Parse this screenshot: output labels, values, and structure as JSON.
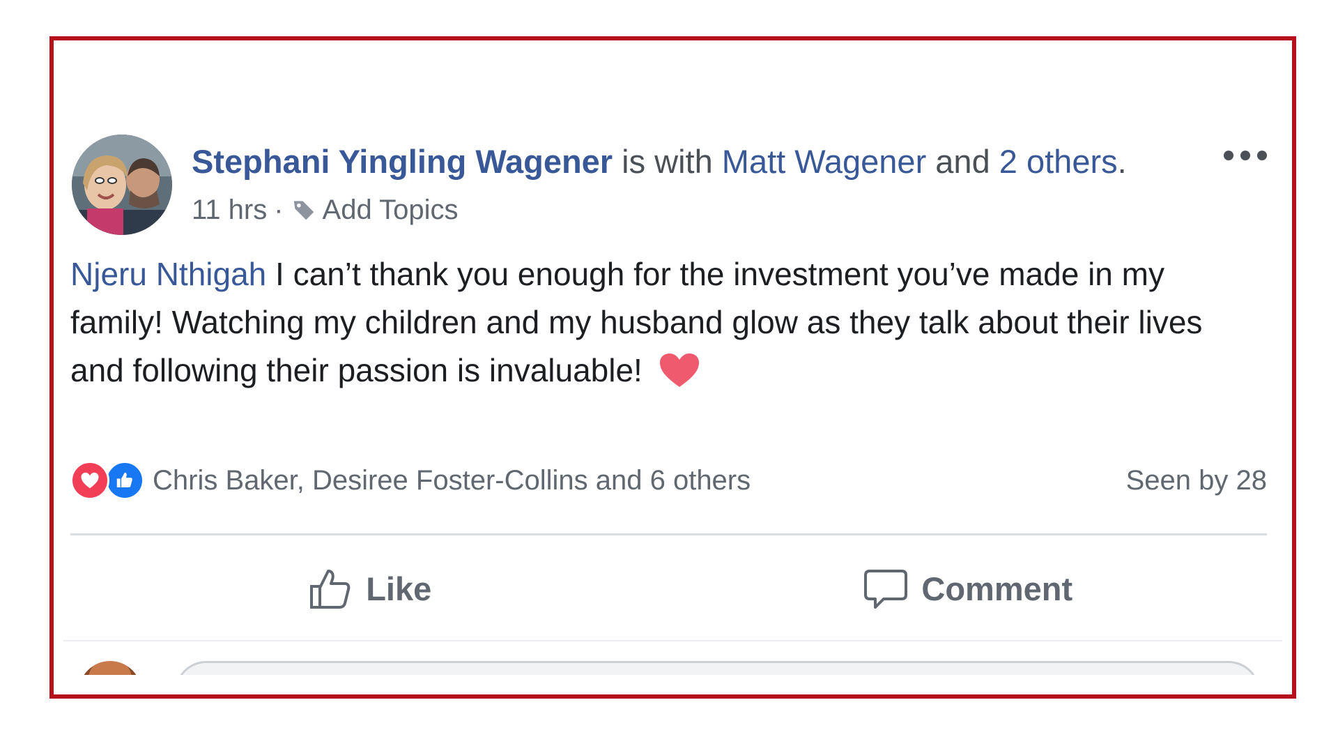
{
  "post": {
    "author": "Stephani Yingling Wagener",
    "with_text": " is with ",
    "tagged_person": "Matt Wagener",
    "and_text": " and ",
    "tagged_others": "2 others",
    "period": ".",
    "time": "11 hrs",
    "meta_sep": "·",
    "add_topics": "Add Topics",
    "mention": "Njeru Nthigah",
    "body": " I can’t thank you enough for the investment you’ve made in my family! Watching my children and my husband glow as they talk about their lives and following their passion is invaluable!",
    "emoji_icon": "red-heart-icon"
  },
  "reactions": {
    "reactors_text": "Chris Baker, Desiree Foster-Collins and 6 others",
    "seen_by": "Seen by 28",
    "icons": [
      "love-reaction-icon",
      "like-reaction-icon"
    ]
  },
  "actions": {
    "like_label": "Like",
    "comment_label": "Comment"
  },
  "colors": {
    "frame_border": "#b5121b",
    "link": "#385898",
    "text": "#1c1e21",
    "secondary_text": "#606770",
    "love": "#f33e58",
    "like": "#1877f2"
  }
}
